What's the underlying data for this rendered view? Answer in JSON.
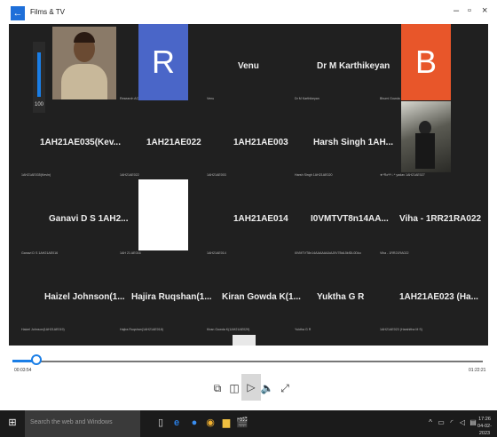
{
  "window": {
    "title": "Films & TV"
  },
  "volume": {
    "value_label": "100"
  },
  "tiles": [
    {
      "name": "Venu",
      "sub": "Venu"
    },
    {
      "name": "Dr M Karthikeyan",
      "sub": "Dr M Karthikeyan"
    },
    {
      "name": "1AH21AE035(Kev...",
      "sub": "1AH21AE035(Kevin)"
    },
    {
      "name": "1AH21AE022",
      "sub": "1AH21AE022"
    },
    {
      "name": "1AH21AE003",
      "sub": "1AH21AE003"
    },
    {
      "name": "Harsh Singh 1AH...",
      "sub": "Harsh Singh 1AH21AE020"
    },
    {
      "name": "Ganavi D S 1AH2...",
      "sub": "Ganavi D S 1AH21AE016"
    },
    {
      "name": "1AH21AE014",
      "sub": "1AH21AE014"
    },
    {
      "name": "I0VMTVT8n14AA...",
      "sub": "I0VMTVT8n14AAAAAAAAJ0V7BdL5kfDL0Dko"
    },
    {
      "name": "Viha - 1RR21RA022",
      "sub": "Viha - 1RR21RA022"
    },
    {
      "name": "Haizel Johnson(1...",
      "sub": "Haizel Johnson(1AH21AE019)"
    },
    {
      "name": "Hajira Ruqshan(1...",
      "sub": "Hajira Ruqshan(1AH21AE018)"
    },
    {
      "name": "Kiran Gowda K(1...",
      "sub": "Kiran Gowda K(1AH21AE029)"
    },
    {
      "name": "Yuktha G R",
      "sub": "Yuktha G R"
    },
    {
      "name": "1AH21AE023 (Ha...",
      "sub": "1AH21AE023 (Harshitha M S)"
    }
  ],
  "tile_letters": {
    "r": "R",
    "b": "B"
  },
  "extra_subs": {
    "presenter": "Research ACS College of Engineering",
    "r_tile": "1AH21AE022",
    "b_tile": "Bhumi Gowda",
    "photo_tile": "★*Ro*l*☆* yadav 1AH21AE027",
    "white_tile": "1AH 21 AE016"
  },
  "playback": {
    "elapsed": "00:03:54",
    "total": "01:22:21",
    "progress": 0.054
  },
  "taskbar": {
    "search_placeholder": "Search the web and Windows",
    "time": "17:26",
    "date": "04-02-2023"
  },
  "colors": {
    "accent": "#1a7ee6",
    "r_tile": "#4a66c8",
    "b_tile": "#e8562a"
  }
}
